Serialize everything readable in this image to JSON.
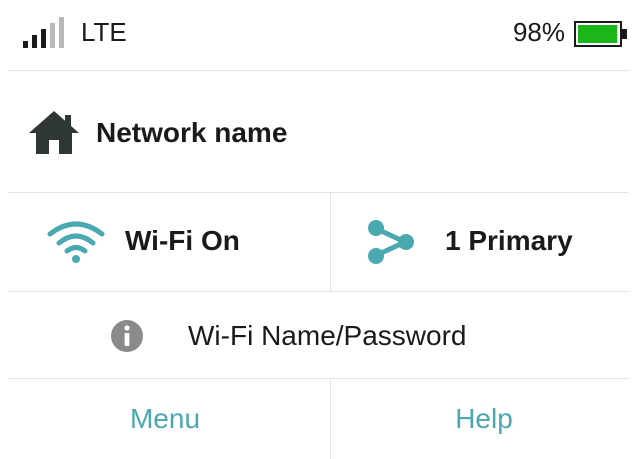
{
  "status_bar": {
    "network_type": "LTE",
    "battery_percent": "98%",
    "signal_bars": 3,
    "signal_bars_total": 5,
    "battery_level": 0.98,
    "battery_color": "#1bb61b"
  },
  "network": {
    "name": "Network name",
    "icon": "home-icon"
  },
  "wifi": {
    "label": "Wi-Fi On",
    "icon": "wifi-icon"
  },
  "devices": {
    "label": "1 Primary",
    "icon": "share-icon"
  },
  "wifi_credentials": {
    "label": "Wi-Fi Name/Password",
    "icon": "info-icon"
  },
  "bottom_nav": {
    "menu_label": "Menu",
    "help_label": "Help"
  },
  "colors": {
    "accent": "#4aa8b0",
    "text": "#1a1a1a",
    "icon_dark": "#2e3636",
    "icon_gray": "#8a8a8a",
    "divider": "#e3e3e3"
  }
}
